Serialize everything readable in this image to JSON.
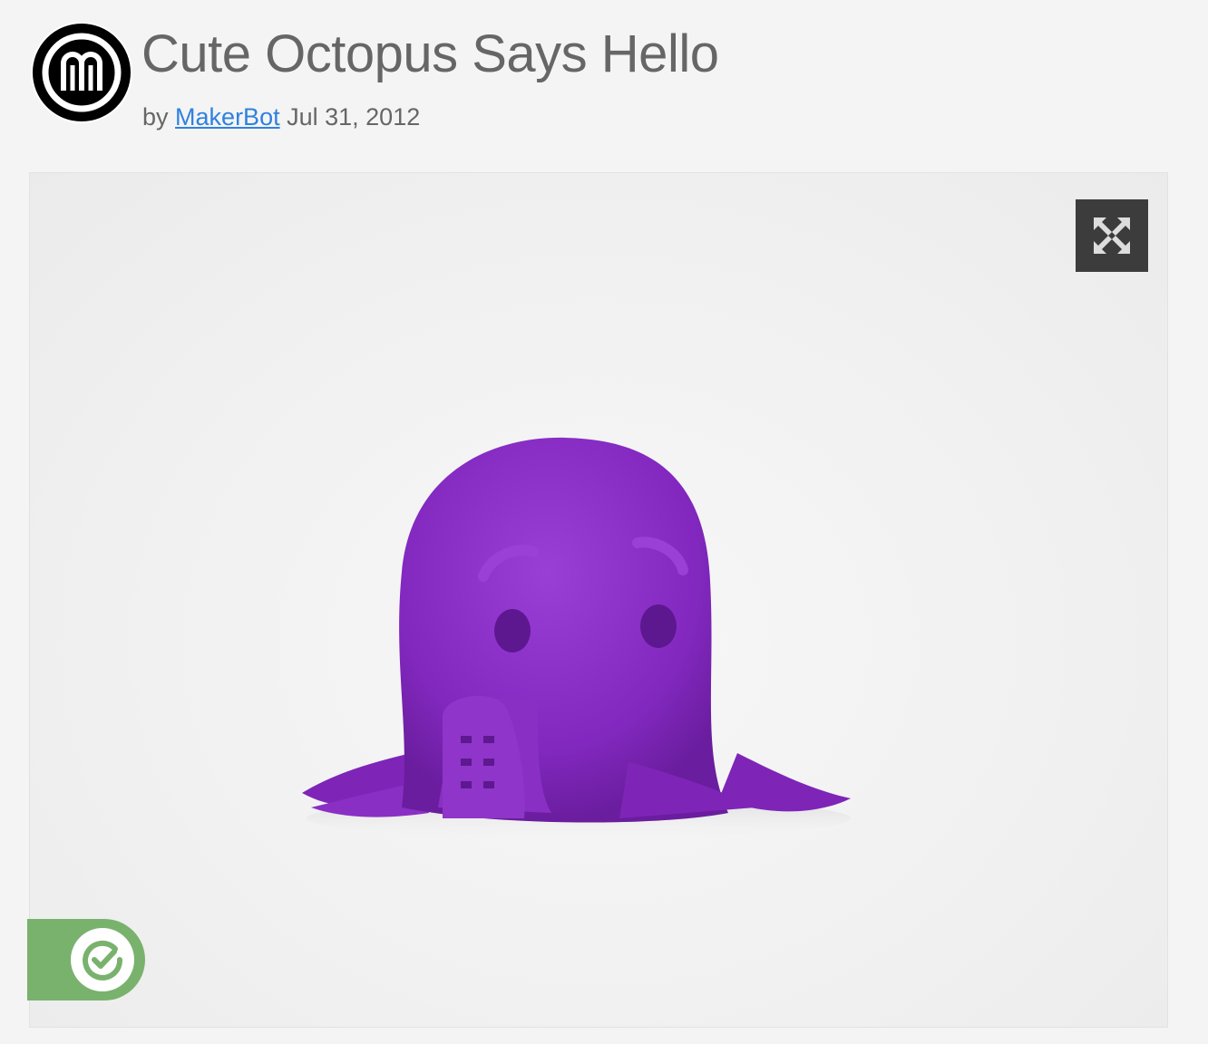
{
  "thing": {
    "title": "Cute Octopus Says Hello",
    "by_prefix": "by",
    "author": "MakerBot",
    "date": "Jul 31, 2012"
  },
  "avatar": {
    "icon": "makerbot-logo-icon",
    "color": "#000000"
  },
  "viewer": {
    "image_subject": "octopus-photo",
    "expand_icon": "expand-arrows-icon",
    "badge_icon": "check-circle-icon",
    "badge_color": "#79b26d",
    "subject_color": "#8a2fc4"
  },
  "colors": {
    "link": "#2f82de",
    "text": "#666666",
    "background": "#f4f4f4"
  }
}
